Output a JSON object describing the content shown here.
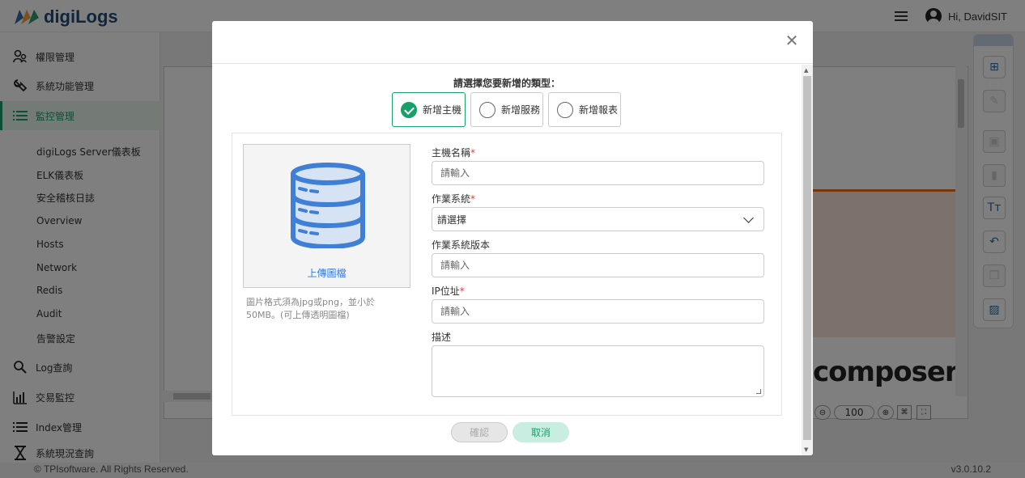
{
  "app": {
    "logo_text": "digiLogs",
    "user_greeting": "Hi, DavidSIT",
    "footer_copyright": "© TPIsoftware. All Rights Reserved.",
    "version": "v3.0.10.2"
  },
  "sidebar": {
    "items": [
      {
        "label": "權限管理",
        "icon": "permission-icon"
      },
      {
        "label": "系統功能管理",
        "icon": "wrench-icon"
      },
      {
        "label": "監控管理",
        "icon": "list-icon"
      }
    ],
    "sub_items": [
      "digiLogs Server儀表板",
      "ELK儀表板",
      "安全稽核日誌",
      "Overview",
      "Hosts",
      "Network",
      "Redis",
      "Audit",
      "告警設定"
    ],
    "bottom_items": [
      {
        "label": "Log查詢",
        "icon": "search-icon"
      },
      {
        "label": "交易監控",
        "icon": "bar-chart-icon"
      },
      {
        "label": "Index管理",
        "icon": "list-icon"
      },
      {
        "label": "系統現況查詢",
        "icon": "hourglass-icon"
      }
    ]
  },
  "canvas": {
    "composer_text": "composer",
    "zoom_value": "100"
  },
  "modal": {
    "choose_label": "請選擇您要新增的類型：",
    "type_options": [
      "新增主機",
      "新增服務",
      "新增報表"
    ],
    "selected_type": "新增主機",
    "upload_link": "上傳圖檔",
    "upload_hint": "圖片格式須為jpg或png，並小於50MB。(可上傳透明圖檔)",
    "fields": {
      "host_name_label": "主機名稱",
      "host_name_placeholder": "請輸入",
      "os_label": "作業系統",
      "os_placeholder": "請選擇",
      "os_version_label": "作業系統版本",
      "os_version_placeholder": "請輸入",
      "ip_label": "IP位址",
      "ip_placeholder": "請輸入",
      "desc_label": "描述"
    },
    "confirm_label": "確認",
    "cancel_label": "取消"
  }
}
